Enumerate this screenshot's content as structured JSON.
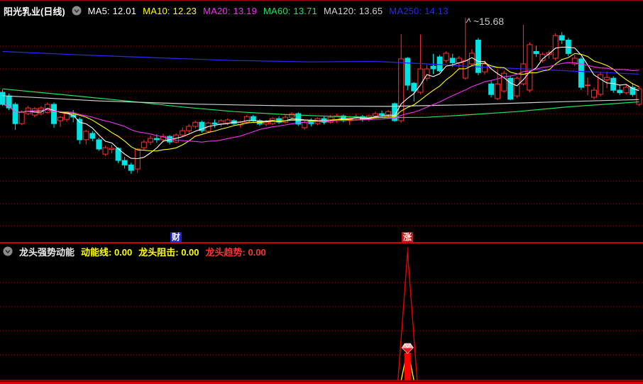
{
  "window": {
    "title": "阳光乳业(日线)"
  },
  "legend": {
    "items": [
      {
        "name": "MA5",
        "text": "MA5: 12.01",
        "color": "#ffffff"
      },
      {
        "name": "MA10",
        "text": "MA10: 12.23",
        "color": "#ffff00"
      },
      {
        "name": "MA20",
        "text": "MA20: 13.19",
        "color": "#f032f0"
      },
      {
        "name": "MA60",
        "text": "MA60: 13.71",
        "color": "#1ee65a"
      },
      {
        "name": "MA120",
        "text": "MA120: 13.65",
        "color": "#d2d2d2"
      },
      {
        "name": "MA250",
        "text": "MA250: 14.13",
        "color": "#2828f5"
      }
    ]
  },
  "chart_data": {
    "type": "candlestick",
    "periodicity": "daily",
    "title": "阳光乳业(日线)",
    "grid": "horizontal-dotted-red",
    "grid_color": "#a00000",
    "up_color": "#ff3232",
    "down_color": "#00e2e2",
    "ylim": [
      5.96,
      15.84
    ],
    "gridline_prices": [
      14.43,
      13.43,
      12.46,
      11.46,
      10.46,
      9.49,
      8.49,
      7.49,
      6.52
    ],
    "price_annotation": {
      "text": "~15.68",
      "value": 15.68,
      "candle_index": 72,
      "color": "#c8c8c8"
    },
    "event_tags": [
      {
        "label": "财",
        "bg": "#2121c3",
        "candle_index": 27
      },
      {
        "label": "涨",
        "bg": "#c81414",
        "candle_index": 63
      }
    ],
    "candles": [
      [
        12.4,
        12.52,
        11.8,
        11.87
      ],
      [
        12.24,
        12.35,
        11.62,
        11.71
      ],
      [
        11.87,
        11.95,
        10.74,
        11.02
      ],
      [
        11.02,
        11.6,
        10.95,
        11.52
      ],
      [
        11.46,
        11.8,
        11.4,
        11.71
      ],
      [
        11.4,
        11.75,
        11.3,
        11.68
      ],
      [
        11.46,
        11.8,
        11.38,
        11.71
      ],
      [
        11.52,
        11.95,
        11.45,
        11.87
      ],
      [
        11.87,
        11.95,
        10.84,
        11.02
      ],
      [
        11.15,
        11.35,
        10.88,
        11.3
      ],
      [
        11.21,
        11.55,
        11.1,
        11.46
      ],
      [
        11.4,
        11.62,
        11.08,
        11.31
      ],
      [
        11.21,
        11.3,
        10.12,
        10.31
      ],
      [
        10.31,
        10.75,
        10.1,
        10.68
      ],
      [
        10.59,
        10.7,
        10.25,
        10.37
      ],
      [
        10.31,
        10.4,
        9.82,
        9.9
      ],
      [
        9.68,
        10.05,
        9.6,
        9.96
      ],
      [
        9.88,
        10.08,
        9.72,
        9.93
      ],
      [
        9.93,
        9.98,
        9.28,
        9.4
      ],
      [
        9.4,
        9.55,
        9.05,
        9.2
      ],
      [
        9.2,
        9.3,
        8.81,
        8.96
      ],
      [
        9.02,
        9.95,
        8.85,
        9.9
      ],
      [
        9.96,
        10.3,
        9.88,
        10.21
      ],
      [
        10.21,
        10.5,
        10.08,
        10.37
      ],
      [
        10.37,
        10.55,
        10.18,
        10.31
      ],
      [
        10.31,
        10.58,
        10.2,
        10.46
      ],
      [
        10.46,
        10.52,
        10.1,
        10.21
      ],
      [
        10.21,
        10.6,
        10.15,
        10.52
      ],
      [
        10.52,
        10.85,
        10.45,
        10.71
      ],
      [
        10.71,
        11.0,
        10.6,
        10.9
      ],
      [
        10.9,
        11.15,
        10.8,
        11.08
      ],
      [
        11.08,
        11.15,
        10.62,
        10.71
      ],
      [
        10.68,
        11.1,
        10.6,
        11.05
      ],
      [
        11.05,
        11.2,
        10.85,
        11.0
      ],
      [
        11.0,
        11.21,
        10.88,
        11.15
      ],
      [
        11.05,
        11.25,
        10.95,
        11.18
      ],
      [
        11.15,
        11.22,
        10.92,
        11.02
      ],
      [
        10.96,
        11.15,
        10.85,
        11.08
      ],
      [
        11.08,
        11.4,
        11.0,
        11.33
      ],
      [
        11.33,
        11.4,
        11.05,
        11.15
      ],
      [
        11.15,
        11.22,
        10.92,
        11.0
      ],
      [
        11.0,
        11.18,
        10.9,
        11.08
      ],
      [
        11.02,
        11.3,
        10.95,
        11.24
      ],
      [
        11.24,
        11.33,
        11.0,
        11.08
      ],
      [
        11.08,
        11.4,
        11.02,
        11.3
      ],
      [
        11.3,
        11.52,
        11.2,
        11.46
      ],
      [
        11.46,
        11.52,
        10.92,
        11.0
      ],
      [
        10.84,
        11.15,
        10.75,
        11.08
      ],
      [
        11.15,
        11.25,
        10.9,
        11.02
      ],
      [
        11.02,
        11.3,
        10.95,
        11.24
      ],
      [
        11.24,
        11.33,
        10.98,
        11.08
      ],
      [
        11.08,
        11.4,
        11.02,
        11.3
      ],
      [
        11.15,
        11.45,
        11.05,
        11.36
      ],
      [
        11.36,
        11.42,
        11.08,
        11.15
      ],
      [
        11.15,
        11.35,
        10.95,
        11.27
      ],
      [
        11.27,
        11.45,
        11.15,
        11.33
      ],
      [
        11.33,
        11.4,
        11.1,
        11.21
      ],
      [
        11.21,
        11.42,
        11.12,
        11.36
      ],
      [
        11.36,
        11.55,
        11.25,
        11.46
      ],
      [
        11.46,
        11.6,
        11.3,
        11.4
      ],
      [
        11.4,
        11.62,
        11.3,
        11.55
      ],
      [
        11.9,
        11.95,
        11.1,
        11.15
      ],
      [
        11.15,
        14.96,
        11.05,
        13.87
      ],
      [
        13.9,
        13.95,
        12.49,
        12.71
      ],
      [
        12.8,
        12.85,
        11.99,
        12.46
      ],
      [
        12.4,
        14.95,
        12.3,
        13.43
      ],
      [
        13.02,
        13.6,
        12.9,
        13.43
      ],
      [
        13.55,
        14.1,
        13.2,
        13.43
      ],
      [
        13.96,
        14.05,
        13.28,
        13.34
      ],
      [
        13.8,
        14.2,
        13.7,
        14.12
      ],
      [
        13.9,
        14.1,
        13.52,
        13.7
      ],
      [
        13.7,
        14.0,
        13.48,
        13.9
      ],
      [
        13.02,
        15.68,
        12.95,
        13.8
      ],
      [
        13.65,
        14.3,
        13.55,
        14.12
      ],
      [
        14.7,
        14.8,
        13.15,
        13.27
      ],
      [
        13.3,
        13.8,
        13.18,
        13.65
      ],
      [
        12.77,
        12.9,
        12.18,
        12.3
      ],
      [
        12.12,
        13.4,
        12.05,
        12.77
      ],
      [
        12.46,
        13.35,
        12.38,
        13.24
      ],
      [
        13.02,
        13.1,
        12.05,
        12.09
      ],
      [
        12.24,
        13.1,
        12.15,
        13.02
      ],
      [
        12.77,
        15.37,
        12.7,
        13.65
      ],
      [
        12.5,
        14.6,
        12.4,
        14.5
      ],
      [
        14.2,
        14.45,
        13.95,
        14.1
      ],
      [
        13.8,
        14.15,
        13.7,
        14.08
      ],
      [
        14.08,
        14.25,
        13.88,
        14.15
      ],
      [
        13.9,
        15.0,
        13.8,
        14.9
      ],
      [
        14.9,
        15.05,
        14.52,
        14.7
      ],
      [
        14.7,
        14.8,
        14.0,
        14.11
      ],
      [
        13.65,
        14.05,
        13.55,
        13.9
      ],
      [
        13.87,
        13.95,
        12.5,
        12.62
      ],
      [
        12.7,
        13.05,
        12.28,
        12.72
      ],
      [
        12.18,
        12.62,
        12.08,
        12.49
      ],
      [
        12.31,
        13.3,
        12.22,
        13.18
      ],
      [
        12.95,
        13.32,
        12.58,
        13.05
      ],
      [
        13.02,
        13.1,
        12.38,
        12.49
      ],
      [
        12.49,
        12.75,
        12.28,
        12.38
      ],
      [
        12.38,
        12.72,
        12.3,
        12.62
      ],
      [
        12.62,
        12.8,
        12.2,
        12.3
      ],
      [
        11.87,
        12.65,
        11.8,
        12.55
      ]
    ],
    "ma_computed": [
      {
        "name": "MA5",
        "period": 5,
        "color": "#ffffff"
      },
      {
        "name": "MA10",
        "period": 10,
        "color": "#ffff00"
      },
      {
        "name": "MA20",
        "period": 20,
        "color": "#f032f0"
      }
    ],
    "ma_overlays": [
      {
        "name": "MA60",
        "color": "#1ee65a",
        "points": [
          [
            0,
            12.55
          ],
          [
            10,
            12.28
          ],
          [
            20,
            12.0
          ],
          [
            28,
            11.75
          ],
          [
            36,
            11.55
          ],
          [
            44,
            11.42
          ],
          [
            52,
            11.33
          ],
          [
            60,
            11.28
          ],
          [
            66,
            11.3
          ],
          [
            72,
            11.4
          ],
          [
            80,
            11.55
          ],
          [
            88,
            11.76
          ],
          [
            99,
            11.98
          ]
        ]
      },
      {
        "name": "MA120",
        "color": "#d2d2d2",
        "points": [
          [
            0,
            12.25
          ],
          [
            15,
            12.02
          ],
          [
            30,
            11.88
          ],
          [
            45,
            11.8
          ],
          [
            60,
            11.78
          ],
          [
            72,
            11.85
          ],
          [
            85,
            11.97
          ],
          [
            99,
            12.08
          ]
        ]
      },
      {
        "name": "MA250",
        "color": "#2828f5",
        "points": [
          [
            0,
            14.2
          ],
          [
            12,
            14.05
          ],
          [
            24,
            13.92
          ],
          [
            36,
            13.8
          ],
          [
            48,
            13.74
          ],
          [
            58,
            13.76
          ],
          [
            66,
            13.65
          ],
          [
            74,
            13.52
          ],
          [
            82,
            13.42
          ],
          [
            90,
            13.32
          ],
          [
            99,
            13.2
          ]
        ]
      }
    ]
  },
  "indicator_panel": {
    "name": "龙头强势动能",
    "fields": [
      {
        "text": "动能线: 0.00",
        "color": "#ffff00"
      },
      {
        "text": "龙头阻击: 0.00",
        "color": "#ffff00"
      },
      {
        "text": "龙头趋势: 0.00",
        "color": "#ff3232"
      }
    ],
    "signal": {
      "candle_index": 63,
      "shape": "spike-with-gem",
      "colors": {
        "outer": "#e80000",
        "inner": "#ffff00",
        "bar": "#ff0000",
        "gem_top": "#ffb4b4",
        "gem_body": "#e61919",
        "baseline": "#d20000"
      }
    }
  }
}
